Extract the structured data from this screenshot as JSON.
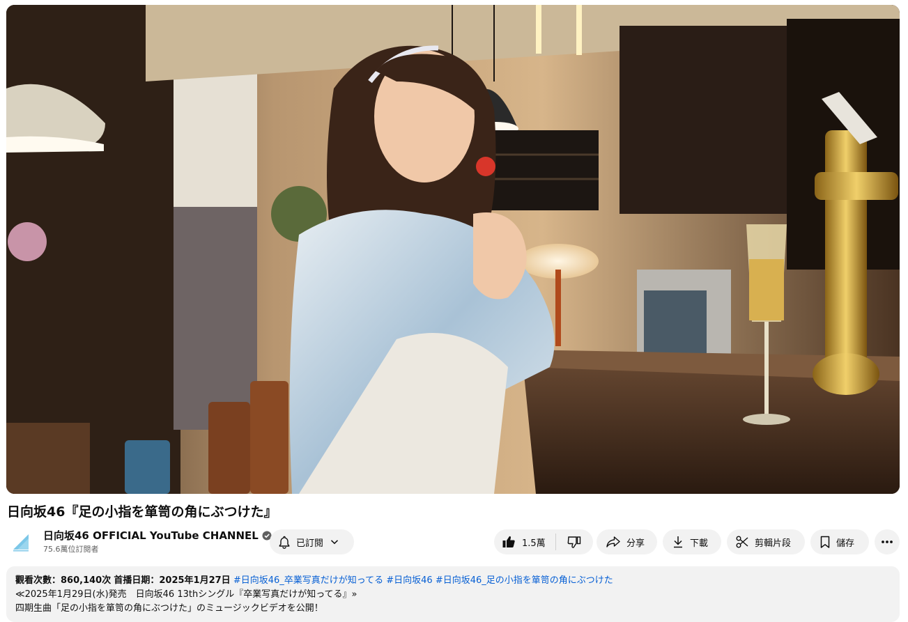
{
  "video": {
    "title": "日向坂46『足の小指を箪笥の角にぶつけた』"
  },
  "owner": {
    "channel_name": "日向坂46 OFFICIAL YouTube CHANNEL",
    "subscribers": "75.6萬位訂閱者"
  },
  "actions": {
    "subscribe_label": "已訂閱",
    "like_count": "1.5萬",
    "share_label": "分享",
    "download_label": "下載",
    "clip_label": "剪輯片段",
    "save_label": "儲存"
  },
  "description": {
    "views": "觀看次數：860,140次",
    "date": "首播日期：2025年1月27日",
    "tags": [
      "#日向坂46_卒業写真だけが知ってる",
      "#日向坂46",
      "#日向坂46_足の小指を箪笥の角にぶつけた"
    ],
    "line2": "≪2025年1月29日(水)発売　日向坂46 13thシングル『卒業写真だけが知ってる』»",
    "line3": "四期生曲「足の小指を箪笥の角にぶつけた」のミュージックビデオを公開！"
  },
  "colors": {
    "accent_link": "#065fd4",
    "chip_bg": "#f2f2f2",
    "brand_blue": "#7cc7e8"
  },
  "icons": {
    "subscribe": "bell-icon",
    "like": "thumbs-up-icon",
    "dislike": "thumbs-down-icon",
    "share": "share-arrow-icon",
    "download": "download-icon",
    "clip": "scissors-icon",
    "save": "bookmark-icon",
    "more": "more-horizontal-icon"
  }
}
